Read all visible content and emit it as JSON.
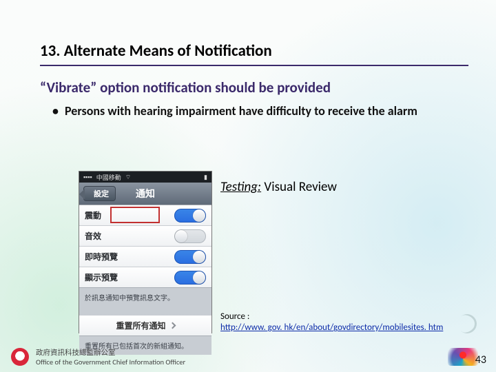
{
  "title": "13. Alternate Means of Notification",
  "subtitle": "“Vibrate” option notification should be provided",
  "bullets": [
    "Persons with hearing impairment have difficulty to receive the alarm"
  ],
  "testing": {
    "label": "Testing:",
    "value": "Visual Review"
  },
  "source": {
    "label": "Source :",
    "url": "http://www. gov. hk/en/about/govdirectory/mobilesites. htm"
  },
  "phone": {
    "carrier": "中國移動",
    "back": "設定",
    "navTitle": "通知",
    "rows": [
      {
        "label": "震動",
        "on": true
      },
      {
        "label": "音效",
        "on": false
      },
      {
        "label": "即時預覽",
        "on": true
      },
      {
        "label": "顯示預覽",
        "on": true
      }
    ],
    "note1": "於訊息通知中預覽訊息文字。",
    "resetLabel": "重置所有通知",
    "note2": "重置所有已包括首次的新組通知。"
  },
  "footer": {
    "office_zh": "政府資訊科技總監辦公室",
    "office_en": "Office of the Government Chief Information Officer"
  },
  "pageNumber": "43"
}
